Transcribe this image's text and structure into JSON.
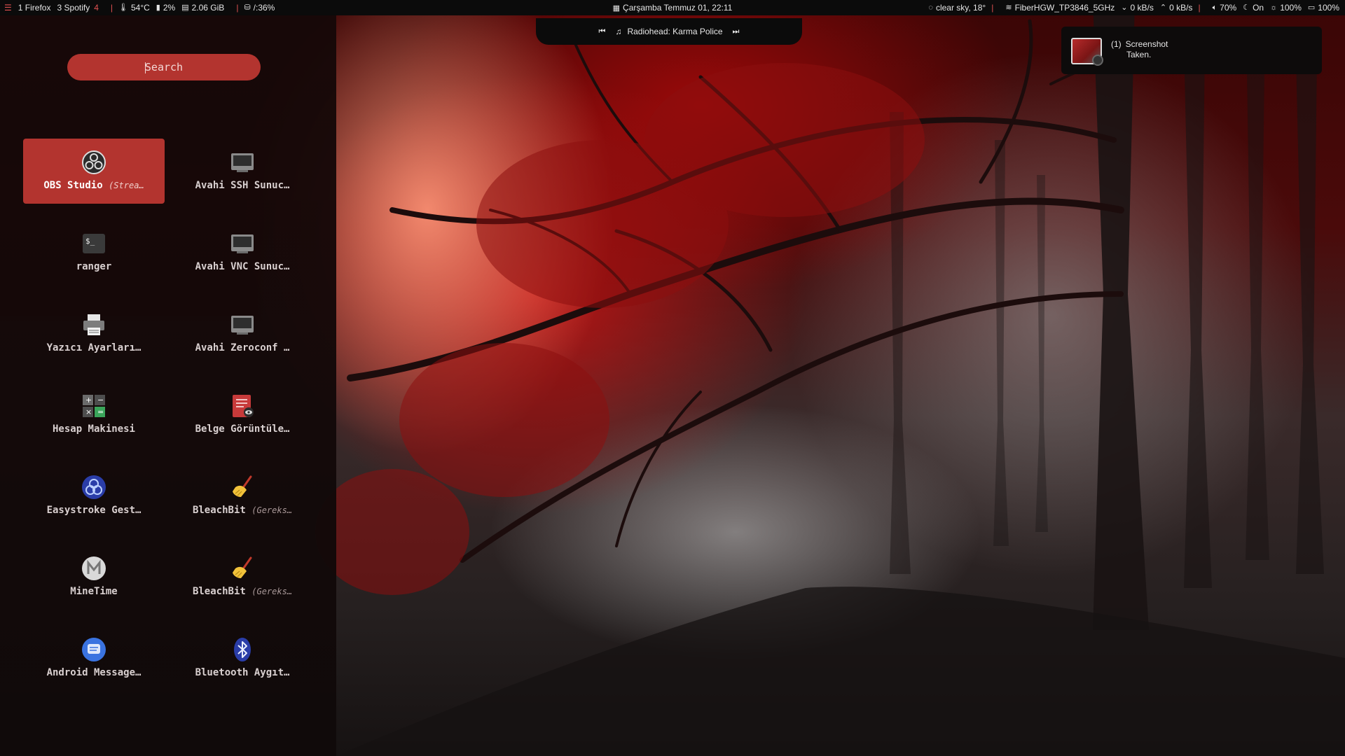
{
  "topbar": {
    "left": {
      "workspaces": [
        {
          "index": "1",
          "label": "Firefox"
        },
        {
          "index": "3",
          "label": "Spotify"
        }
      ],
      "badge": "4",
      "temperature": "54°C",
      "cpu": "2%",
      "memory": "2.06 GiB",
      "disk": "/:36%"
    },
    "datetime": "Çarşamba Temmuz 01,  22:11",
    "right": {
      "weather": "clear sky, 18°",
      "wifi": "FiberHGW_TP3846_5GHz",
      "down": "0 kB/s",
      "up": "0 kB/s",
      "volume": "70%",
      "night": "On",
      "brightness": "100%",
      "battery": "100%"
    }
  },
  "media": {
    "track": "Radiohead: Karma Police"
  },
  "notification": {
    "count": "(1)",
    "line1": "Screenshot",
    "line2": "Taken."
  },
  "launcher": {
    "search": {
      "placeholder": "Search"
    },
    "apps": [
      {
        "name": "OBS Studio",
        "sub": "(Strea…",
        "icon": "obs-icon",
        "active": true
      },
      {
        "name": "Avahi SSH Sunuc…",
        "sub": "",
        "icon": "network-server-icon"
      },
      {
        "name": "ranger",
        "sub": "",
        "icon": "terminal-icon"
      },
      {
        "name": "Avahi VNC Sunuc…",
        "sub": "",
        "icon": "network-server-icon"
      },
      {
        "name": "Yazıcı Ayarları…",
        "sub": "",
        "icon": "printer-icon"
      },
      {
        "name": "Avahi Zeroconf …",
        "sub": "",
        "icon": "network-server-icon"
      },
      {
        "name": "Hesap Makinesi",
        "sub": "",
        "icon": "calculator-icon"
      },
      {
        "name": "Belge Görüntüle…",
        "sub": "",
        "icon": "document-viewer-icon"
      },
      {
        "name": "Easystroke Gest…",
        "sub": "",
        "icon": "easystroke-icon"
      },
      {
        "name": "BleachBit",
        "sub": "(Gereks…",
        "icon": "broom-icon"
      },
      {
        "name": "MineTime",
        "sub": "",
        "icon": "minetime-icon"
      },
      {
        "name": "BleachBit",
        "sub": "(Gereks…",
        "icon": "broom-icon"
      },
      {
        "name": "Android Message…",
        "sub": "",
        "icon": "messages-icon"
      },
      {
        "name": "Bluetooth Aygıt…",
        "sub": "",
        "icon": "bluetooth-icon"
      }
    ]
  },
  "colors": {
    "accent": "#b3342f",
    "bar": "#0b0b0b",
    "highlight": "#e25151"
  }
}
